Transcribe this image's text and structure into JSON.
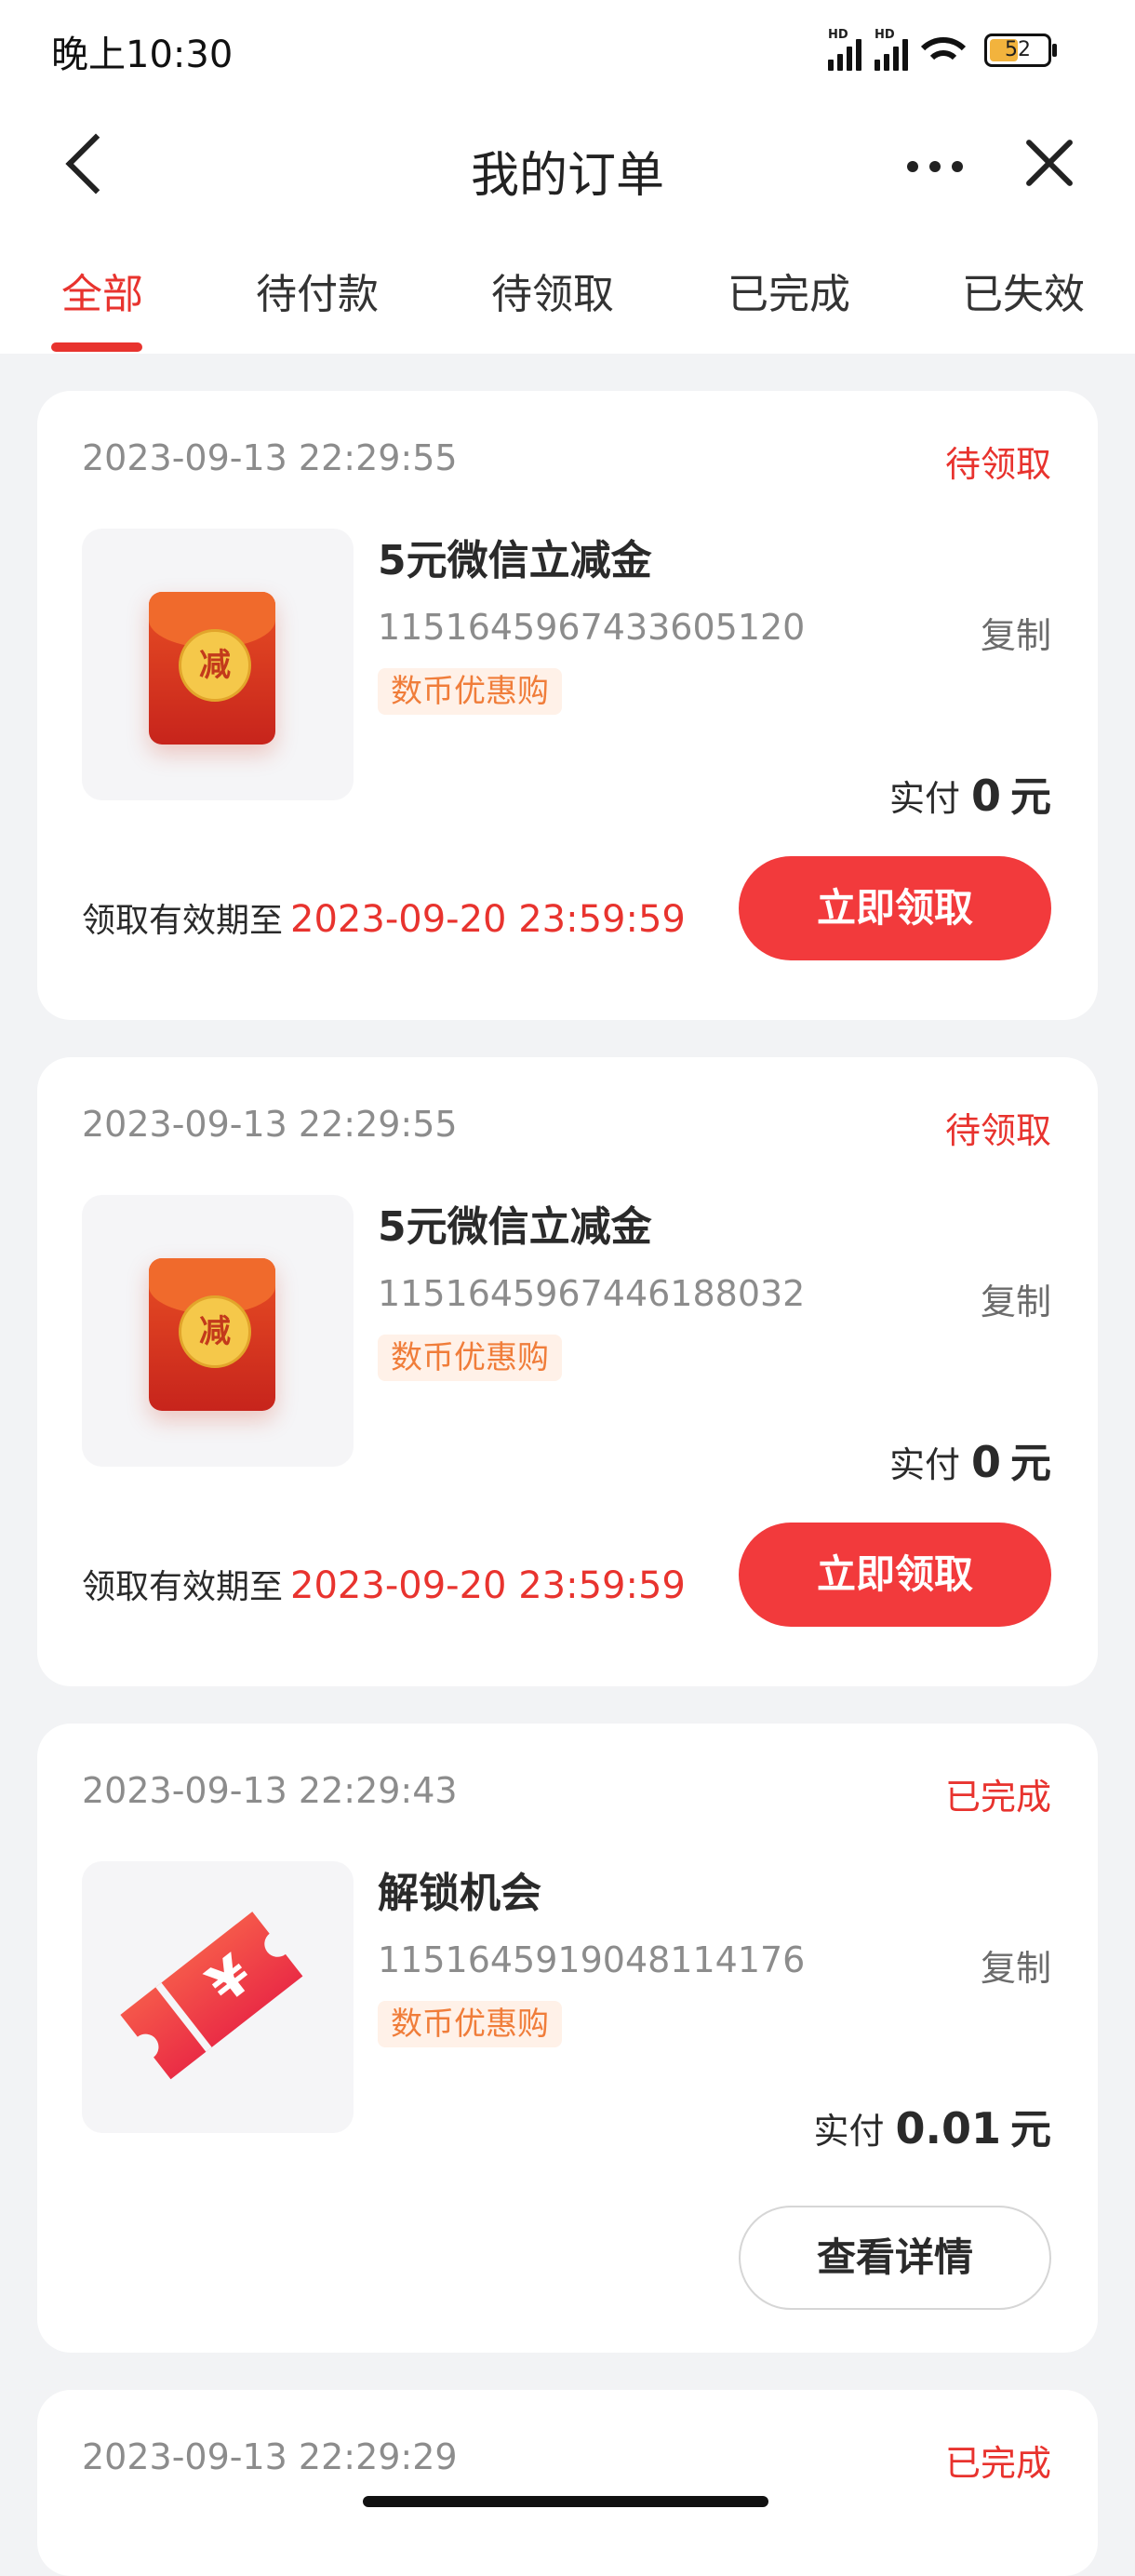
{
  "status_bar": {
    "time": "晚上10:30",
    "signal_label": "HD",
    "battery": "52"
  },
  "header": {
    "title": "我的订单"
  },
  "tabs": [
    {
      "label": "全部",
      "active": true
    },
    {
      "label": "待付款",
      "active": false
    },
    {
      "label": "待领取",
      "active": false
    },
    {
      "label": "已完成",
      "active": false
    },
    {
      "label": "已失效",
      "active": false
    }
  ],
  "colors": {
    "accent": "#e8332e",
    "button": "#f23a3c",
    "tag_text": "#f07d3a",
    "tag_bg": "#fff1e8"
  },
  "orders": [
    {
      "time": "2023-09-13 22:29:55",
      "status": "待领取",
      "name": "5元微信立减金",
      "order_no": "1151645967433605120",
      "copy": "复制",
      "tag": "数币优惠购",
      "paid_label": "实付",
      "paid_amount": "0",
      "paid_unit": "元",
      "expiry_label": "领取有效期至",
      "expiry_date": "2023-09-20 23:59:59",
      "button": "立即领取",
      "icon": "red-envelope",
      "icon_text": "减"
    },
    {
      "time": "2023-09-13 22:29:55",
      "status": "待领取",
      "name": "5元微信立减金",
      "order_no": "1151645967446188032",
      "copy": "复制",
      "tag": "数币优惠购",
      "paid_label": "实付",
      "paid_amount": "0",
      "paid_unit": "元",
      "expiry_label": "领取有效期至",
      "expiry_date": "2023-09-20 23:59:59",
      "button": "立即领取",
      "icon": "red-envelope",
      "icon_text": "减"
    },
    {
      "time": "2023-09-13 22:29:43",
      "status": "已完成",
      "name": "解锁机会",
      "order_no": "1151645919048114176",
      "copy": "复制",
      "tag": "数币优惠购",
      "paid_label": "实付",
      "paid_amount": "0.01",
      "paid_unit": "元",
      "button": "查看详情",
      "icon": "ticket"
    },
    {
      "time": "2023-09-13 22:29:29",
      "status": "已完成"
    }
  ]
}
